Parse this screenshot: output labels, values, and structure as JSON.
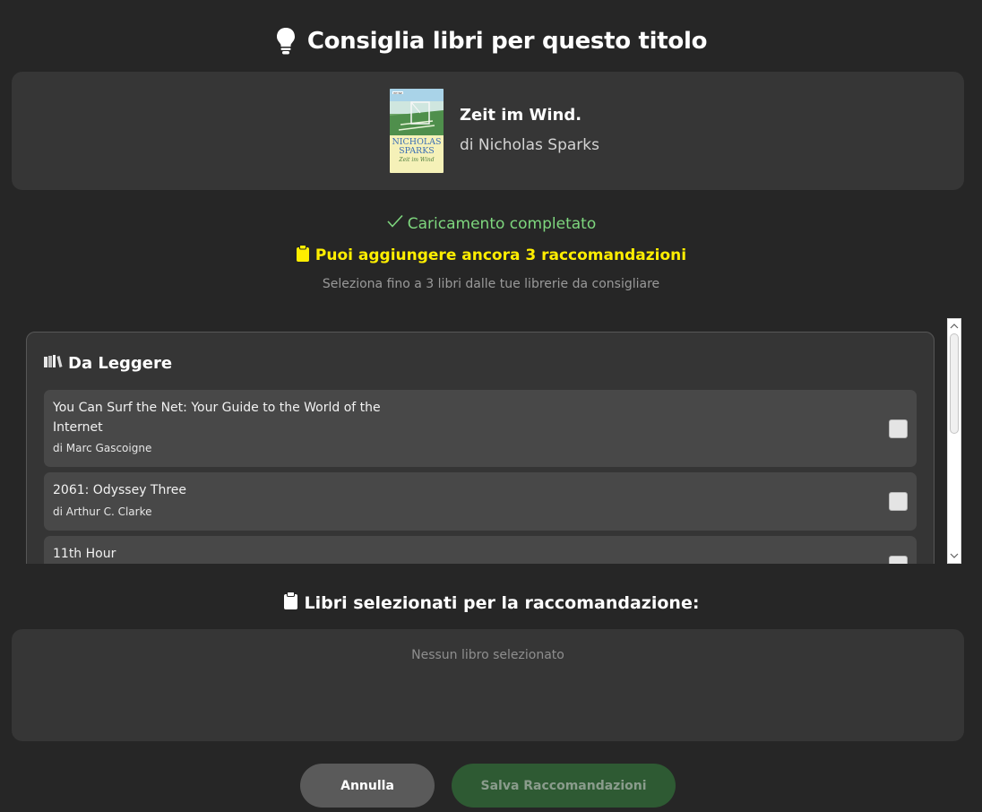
{
  "dialog": {
    "title": "Consiglia libri per questo titolo",
    "icon": "lightbulb-icon"
  },
  "source_book": {
    "title": "Zeit im Wind.",
    "author": "di Nicholas Sparks",
    "cover": {
      "publisher": "HEYNE",
      "author_line1": "NICHOLAS",
      "author_line2": "SPARKS",
      "title": "Zeit im Wind"
    }
  },
  "status": {
    "loaded_text": "Caricamento completato",
    "remaining_text": "Puoi aggiungere ancora 3 raccomandazioni",
    "hint_text": "Seleziona fino a 3 libri dalle tue librerie da consigliare",
    "loaded_color": "#7ed77e",
    "remaining_color": "#ffee00"
  },
  "libraries": [
    {
      "name": "Da Leggere",
      "icon": "books-icon",
      "books": [
        {
          "title": "You Can Surf the Net: Your Guide to the World of the Internet",
          "author": "di Marc Gascoigne",
          "checked": false
        },
        {
          "title": "2061: Odyssey Three",
          "author": "di Arthur C. Clarke",
          "checked": false
        },
        {
          "title": "11th Hour",
          "author": "",
          "checked": false
        }
      ]
    }
  ],
  "selected": {
    "heading": "Libri selezionati per la raccomandazione:",
    "icon": "clipboard-icon",
    "empty_text": "Nessun libro selezionato"
  },
  "buttons": {
    "cancel": "Annulla",
    "save": "Salva Raccomandazioni"
  }
}
